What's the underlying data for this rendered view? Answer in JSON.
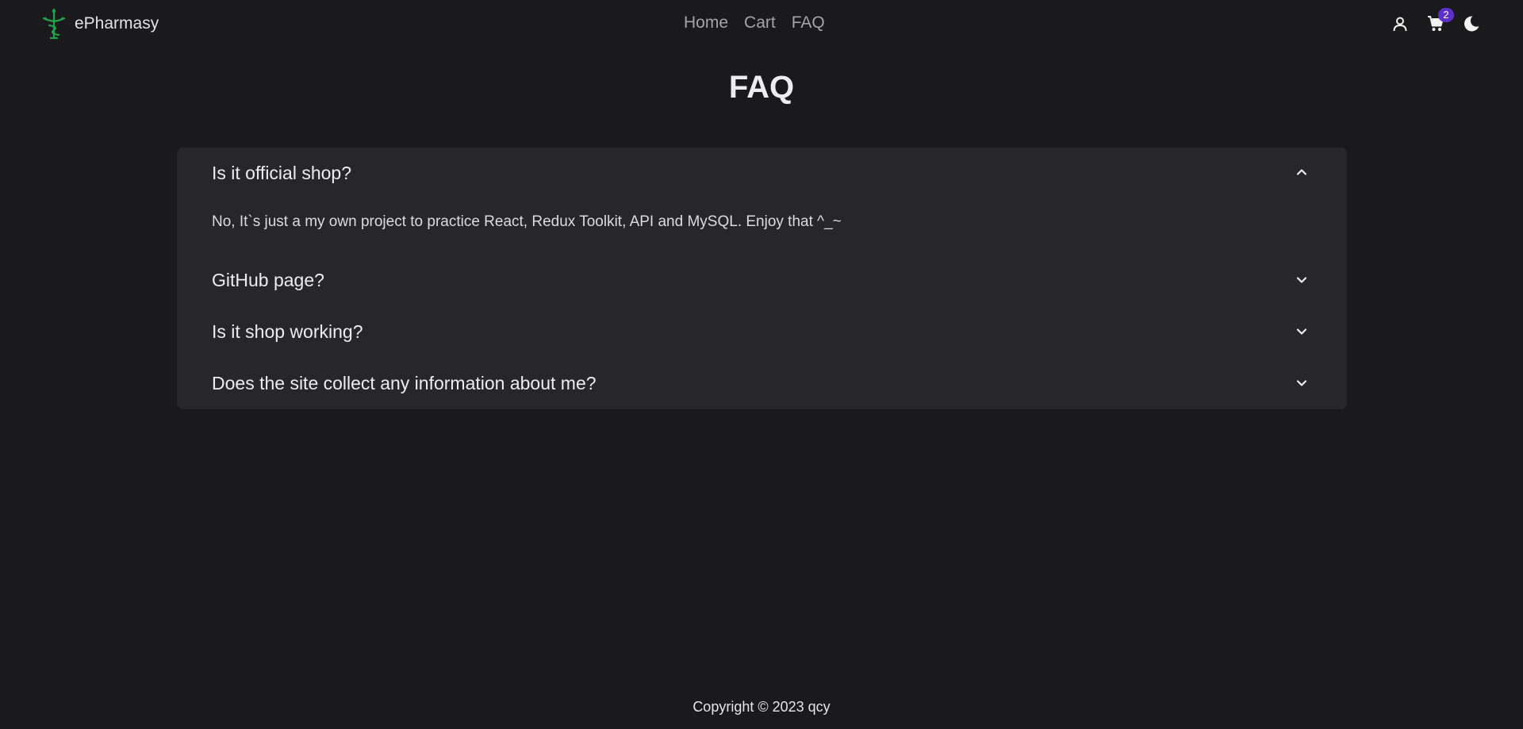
{
  "brand": {
    "name": "ePharmasy",
    "logo_icon": "rod-of-asclepius-bowl-icon",
    "logo_color": "#1fa34a"
  },
  "nav": {
    "links": [
      {
        "label": "Home"
      },
      {
        "label": "Cart"
      },
      {
        "label": "FAQ"
      }
    ],
    "icons": {
      "user": "user-icon",
      "cart": "cart-icon",
      "theme": "moon-icon"
    },
    "cart_count": "2",
    "badge_color": "#5b2fc9"
  },
  "page": {
    "title": "FAQ"
  },
  "faq": {
    "items": [
      {
        "question": "Is it official shop?",
        "answer": "No, It`s just a my own project to practice React, Redux Toolkit, API and MySQL. Enjoy that ^_~",
        "expanded": true
      },
      {
        "question": "GitHub page?",
        "expanded": false
      },
      {
        "question": "Is it shop working?",
        "expanded": false
      },
      {
        "question": "Does the site collect any information about me?",
        "expanded": false
      }
    ]
  },
  "footer": {
    "text": "Copyright © 2023 qcy"
  }
}
